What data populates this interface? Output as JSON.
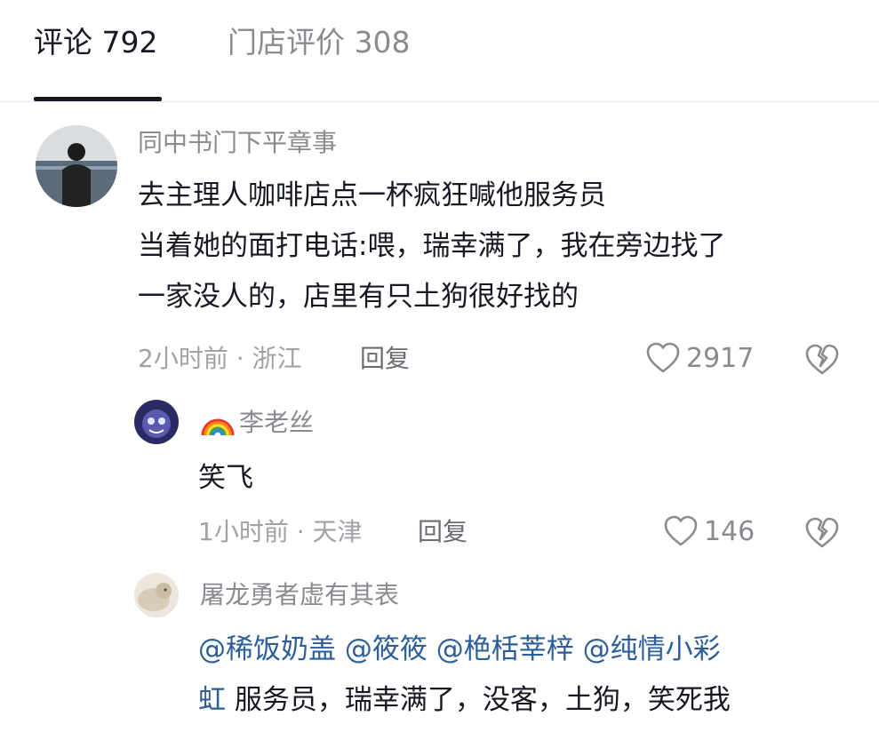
{
  "tabs": {
    "comments": "评论 792",
    "reviews": "门店评价 308"
  },
  "comments": [
    {
      "author": "同中书门下平章事",
      "lines": [
        "去主理人咖啡店点一杯疯狂喊他服务员",
        "当着她的面打电话:喂，瑞幸满了，我在旁边找了",
        "一家没人的，店里有只土狗很好找的"
      ],
      "meta": "2小时前 · 浙江",
      "reply_label": "回复",
      "likes": "2917"
    },
    {
      "author_emoji": "rainbow-emoji",
      "author": "李老丝",
      "lines": [
        "笑飞"
      ],
      "meta": "1小时前 · 天津",
      "reply_label": "回复",
      "likes": "146"
    },
    {
      "author": "屠龙勇者虚有其表",
      "mentions": [
        "@稀饭奶盖",
        "@筱筱",
        "@栬栝莘梓",
        "@纯情小彩"
      ],
      "mention_tail": "虹",
      "text_tail": "服务员，瑞幸满了，没客，土狗，笑死我"
    }
  ],
  "colors": {
    "primary_text": "#161823",
    "secondary_text": "#8a8b91",
    "mention": "#2c5e99"
  }
}
